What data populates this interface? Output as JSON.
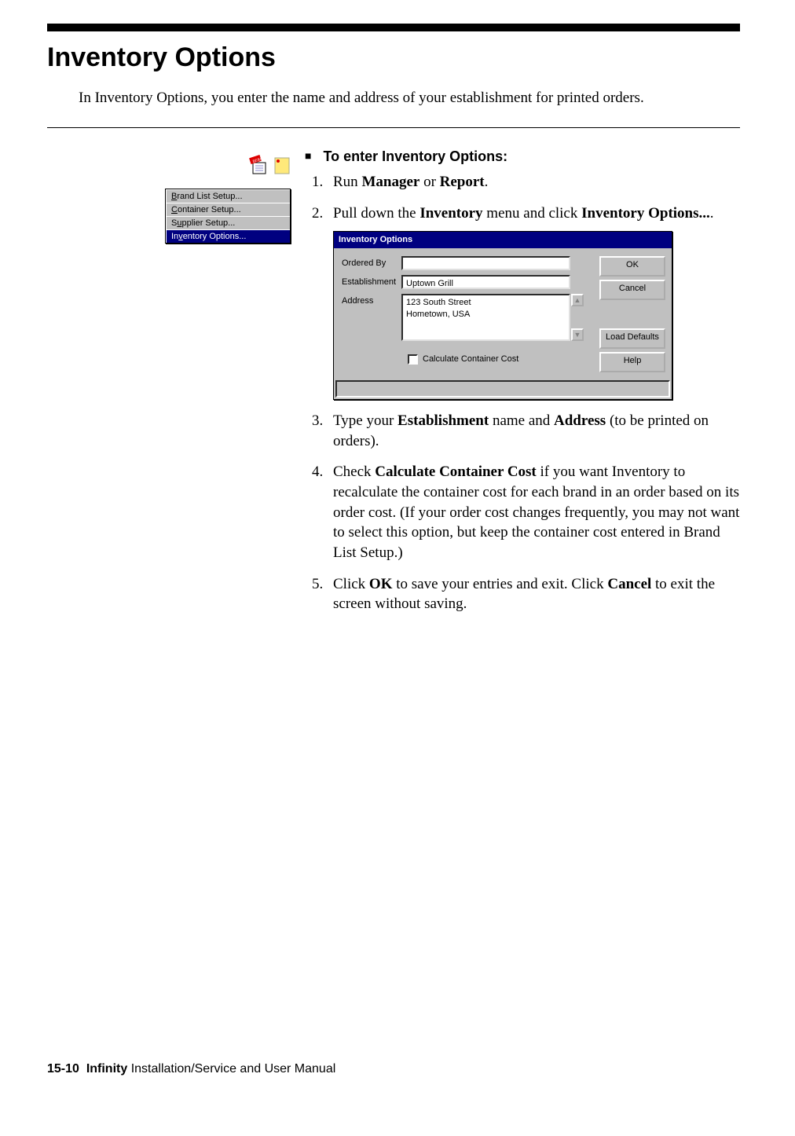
{
  "heading": "Inventory Options",
  "intro": "In Inventory Options, you enter the name and address of your establishment for printed orders.",
  "menu": {
    "items": [
      "Brand List Setup...",
      "Container Setup...",
      "Supplier Setup...",
      "Inventory Options..."
    ],
    "underlinePos": [
      0,
      0,
      1,
      2
    ],
    "selectedIndex": 3
  },
  "task": {
    "title": "To enter Inventory Options:",
    "steps": {
      "s1_pre": "Run ",
      "s1_b1": "Manager",
      "s1_mid": " or ",
      "s1_b2": "Report",
      "s1_post": ".",
      "s2_pre": "Pull down the ",
      "s2_b1": "Inventory",
      "s2_mid": " menu and click ",
      "s2_b2": "Inventory Options...",
      "s2_post": ".",
      "s3_pre": "Type your ",
      "s3_b1": "Establishment",
      "s3_mid": " name and ",
      "s3_b2": "Address",
      "s3_post": " (to be printed on orders).",
      "s4_pre": "Check ",
      "s4_b1": "Calculate Container Cost",
      "s4_post": " if you want Inventory to recalculate the container cost for each brand in an order based on its order cost. (If your order cost changes frequently, you may not want to select this option, but keep the container cost entered in Brand List Setup.)",
      "s5_pre": "Click ",
      "s5_b1": "OK",
      "s5_mid": " to save your entries and exit. Click ",
      "s5_b2": "Cancel",
      "s5_post": " to exit the screen without saving."
    }
  },
  "dialog": {
    "title": "Inventory Options",
    "labels": {
      "orderedBy": "Ordered By",
      "establishment": "Establishment",
      "address": "Address",
      "calcCost": "Calculate Container Cost"
    },
    "values": {
      "orderedBy": "",
      "establishment": "Uptown Grill",
      "address": "123 South Street\nHometown, USA"
    },
    "buttons": {
      "ok": "OK",
      "cancel": "Cancel",
      "loadDefaults": "Load Defaults",
      "help": "Help"
    }
  },
  "footer": {
    "pagenum": "15-10",
    "product": "Infinity",
    "rest": " Installation/Service and User Manual"
  }
}
